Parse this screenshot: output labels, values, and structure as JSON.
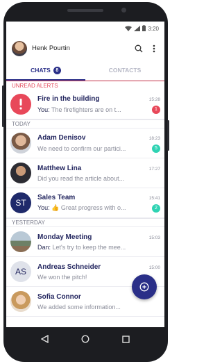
{
  "status": {
    "time": "3:20"
  },
  "header": {
    "username": "Henk Pourtin"
  },
  "tabs": [
    {
      "label": "CHATS",
      "badge": "8"
    },
    {
      "label": "CONTACTS"
    }
  ],
  "sections": {
    "unread": "UNREAD ALERTS",
    "today": "TODAY",
    "yesterday": "YESTERDAY"
  },
  "chats": [
    {
      "name": "Fire in the building",
      "time": "15:28",
      "sender": "You:",
      "preview": " The firefighters are on t...",
      "unread": "1",
      "badge_color": "#e8485a",
      "avatar_color": "#e8485a"
    },
    {
      "name": "Adam Denisov",
      "time": "18:23",
      "sender": "",
      "preview": "We need to confirm our partici...",
      "unread": "5",
      "badge_color": "#2fd3b3"
    },
    {
      "name": "Matthew Lina",
      "time": "17:27",
      "sender": "",
      "preview": "Did you read the article about..."
    },
    {
      "name": "Sales Team",
      "time": "15:41",
      "sender": "You:",
      "preview": " 👍 Great progress with o...",
      "unread": "2",
      "badge_color": "#2fd3b3",
      "initials": "ST",
      "avatar_color": "#1f2a6b"
    },
    {
      "name": "Monday Meeting",
      "time": "15:03",
      "sender": "Dan:",
      "preview": " Let's try to keep the mee..."
    },
    {
      "name": "Andreas Schneider",
      "time": "15:00",
      "sender": "",
      "preview": "We won the pitch!",
      "initials": "AS",
      "avatar_color": "#dfe2ea"
    },
    {
      "name": "Sofia Connor",
      "time": "",
      "sender": "",
      "preview": "We added some information..."
    }
  ]
}
